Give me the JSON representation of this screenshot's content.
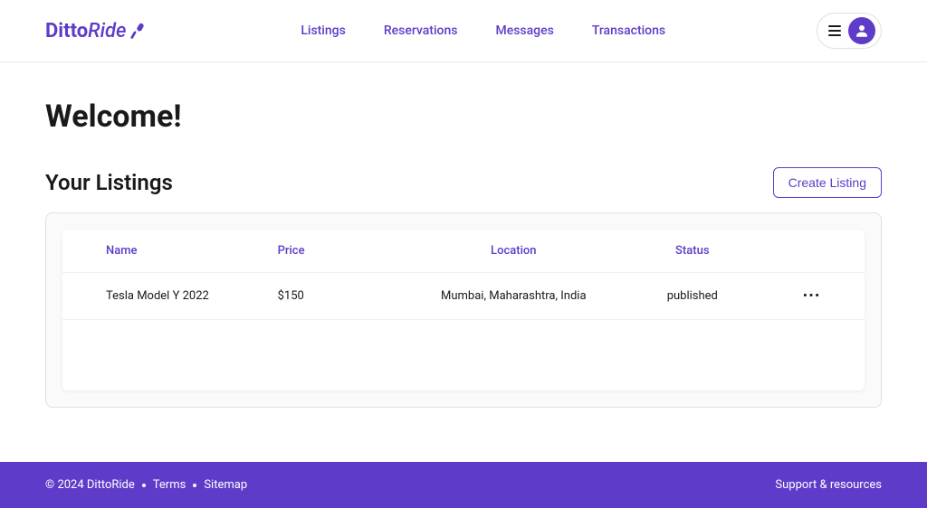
{
  "brand": {
    "part1": "Ditto",
    "part2": "Ride"
  },
  "nav": {
    "listings": "Listings",
    "reservations": "Reservations",
    "messages": "Messages",
    "transactions": "Transactions"
  },
  "page": {
    "title": "Welcome!",
    "section_title": "Your Listings",
    "create_btn": "Create Listing"
  },
  "table": {
    "headers": {
      "name": "Name",
      "price": "Price",
      "location": "Location",
      "status": "Status"
    },
    "rows": [
      {
        "name": "Tesla Model Y 2022",
        "price": "$150",
        "location": "Mumbai, Maharashtra, India",
        "status": "published"
      }
    ]
  },
  "footer": {
    "copyright": "© 2024 DittoRide",
    "terms": "Terms",
    "sitemap": "Sitemap",
    "support": "Support & resources"
  }
}
